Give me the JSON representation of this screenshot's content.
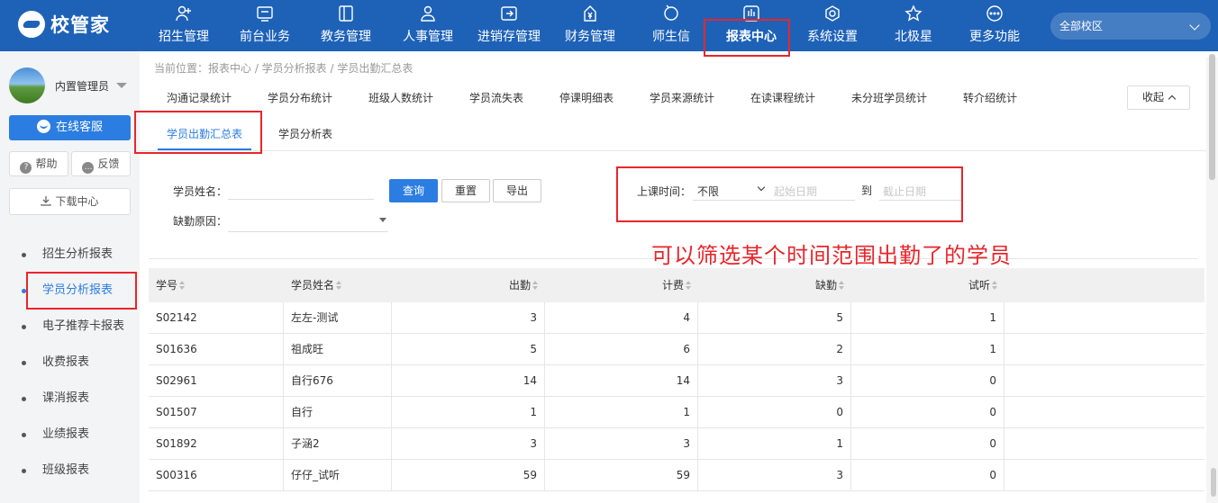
{
  "app": {
    "name": "校管家"
  },
  "nav": {
    "items": [
      {
        "label": "招生管理",
        "icon": "user-plus-icon"
      },
      {
        "label": "前台业务",
        "icon": "monitor-icon"
      },
      {
        "label": "教务管理",
        "icon": "book-icon"
      },
      {
        "label": "人事管理",
        "icon": "person-icon"
      },
      {
        "label": "进销存管理",
        "icon": "box-icon"
      },
      {
        "label": "财务管理",
        "icon": "money-icon"
      },
      {
        "label": "师生信",
        "icon": "chat-icon"
      },
      {
        "label": "报表中心",
        "icon": "report-icon"
      },
      {
        "label": "系统设置",
        "icon": "gear-icon"
      },
      {
        "label": "北极星",
        "icon": "star-icon"
      },
      {
        "label": "更多功能",
        "icon": "more-icon"
      }
    ],
    "active": "报表中心"
  },
  "campus": {
    "value": "全部校区"
  },
  "sidebar": {
    "user": "内置管理员",
    "online_service": "在线客服",
    "help": "帮助",
    "feedback": "反馈",
    "download": "下载中心",
    "items": [
      "招生分析报表",
      "学员分析报表",
      "电子推荐卡报表",
      "收费报表",
      "课消报表",
      "业绩报表",
      "班级报表"
    ],
    "active": "学员分析报表"
  },
  "breadcrumb": "当前位置：报表中心 / 学员分析报表 / 学员出勤汇总表",
  "report_tabs": [
    "沟通记录统计",
    "学员分布统计",
    "班级人数统计",
    "学员流失表",
    "停课明细表",
    "学员来源统计",
    "在读课程统计",
    "未分班学员统计",
    "转介绍统计"
  ],
  "collapse_label": "收起",
  "sub_tabs": [
    "学员出勤汇总表",
    "学员分析表"
  ],
  "active_sub_tab": "学员出勤汇总表",
  "filters": {
    "name_label": "学员姓名：",
    "reason_label": "缺勤原因：",
    "query": "查询",
    "reset": "重置",
    "export": "导出",
    "time_label": "上课时间：",
    "time_value": "不限",
    "start_placeholder": "起始日期",
    "to": "到",
    "end_placeholder": "截止日期"
  },
  "annotation": "可以筛选某个时间范围出勤了的学员",
  "table": {
    "columns": [
      "学号",
      "学员姓名",
      "出勤",
      "计费",
      "缺勤",
      "试听"
    ],
    "rows": [
      [
        "S02142",
        "左左-测试",
        "3",
        "4",
        "5",
        "1"
      ],
      [
        "S01636",
        "祖成旺",
        "5",
        "6",
        "2",
        "1"
      ],
      [
        "S02961",
        "自行676",
        "14",
        "14",
        "3",
        "0"
      ],
      [
        "S01507",
        "自行",
        "1",
        "1",
        "0",
        "0"
      ],
      [
        "S01892",
        "子涵2",
        "3",
        "3",
        "1",
        "0"
      ],
      [
        "S00316",
        "仔仔_试听",
        "59",
        "59",
        "3",
        "0"
      ]
    ]
  },
  "colors": {
    "topbar": "#1e62b8",
    "accent": "#2b7de1",
    "highlight": "#e8262b"
  }
}
